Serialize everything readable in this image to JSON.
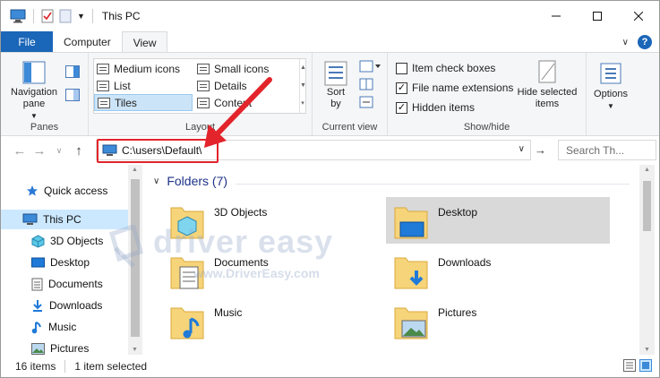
{
  "window": {
    "title": "This PC"
  },
  "tabs": [
    {
      "label": "File"
    },
    {
      "label": "Computer"
    },
    {
      "label": "View"
    }
  ],
  "ribbon": {
    "panes": {
      "label": "Panes",
      "navigation_pane": "Navigation pane"
    },
    "layout": {
      "label": "Layout",
      "items": [
        "Medium icons",
        "Small icons",
        "List",
        "Details",
        "Tiles",
        "Content"
      ],
      "selected": "Tiles"
    },
    "current_view": {
      "label": "Current view",
      "sort_by": "Sort by"
    },
    "show_hide": {
      "label": "Show/hide",
      "item_check_boxes": "Item check boxes",
      "file_name_extensions": "File name extensions",
      "hidden_items": "Hidden items",
      "hide_selected_items": "Hide selected items",
      "checks": {
        "item_check_boxes": false,
        "file_name_extensions": true,
        "hidden_items": true
      }
    },
    "options": "Options"
  },
  "address": {
    "path": "C:\\users\\Default\\",
    "search_placeholder": "Search Th..."
  },
  "sidebar": {
    "items": [
      {
        "label": "Quick access",
        "icon": "star-icon"
      },
      {
        "label": "This PC",
        "icon": "computer-icon",
        "selected": true
      },
      {
        "label": "3D Objects",
        "icon": "cube-icon"
      },
      {
        "label": "Desktop",
        "icon": "desktop-icon"
      },
      {
        "label": "Documents",
        "icon": "document-icon"
      },
      {
        "label": "Downloads",
        "icon": "download-icon"
      },
      {
        "label": "Music",
        "icon": "music-icon"
      },
      {
        "label": "Pictures",
        "icon": "pictures-icon"
      }
    ]
  },
  "content": {
    "group_title": "Folders (7)",
    "folders": [
      {
        "label": "3D Objects"
      },
      {
        "label": "Desktop",
        "selected": true
      },
      {
        "label": "Documents"
      },
      {
        "label": "Downloads"
      },
      {
        "label": "Music"
      },
      {
        "label": "Pictures"
      }
    ]
  },
  "watermark": {
    "brand": "driver easy",
    "url": "www.DriverEasy.com"
  },
  "status": {
    "items": "16 items",
    "selected": "1 item selected"
  },
  "colors": {
    "accent": "#1a66b8",
    "highlight_box": "#e3242b",
    "selection": "#cce8ff"
  }
}
